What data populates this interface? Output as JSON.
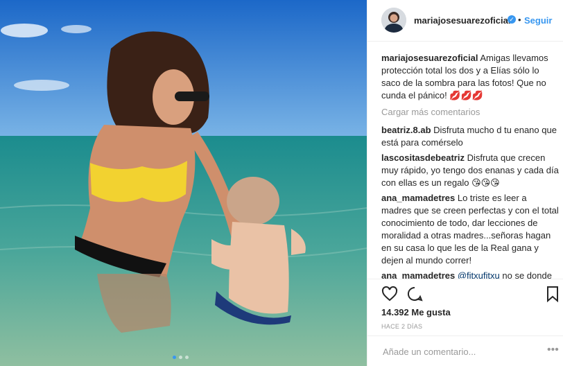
{
  "post": {
    "username": "mariajosesuarezoficial",
    "verified_icon": "verified-badge-icon",
    "separator": "•",
    "follow_label": "Seguir",
    "caption_user": "mariajosesuarezoficial",
    "caption_text": "Amigas llevamos protección total los dos y a Elías sólo lo saco de la sombra para las fotos! Que no cunda el pánico! 💋💋💋",
    "load_more": "Cargar más comentarios",
    "comments": [
      {
        "user": "beatriz.8.ab",
        "text": "Disfruta mucho d tu enano que está para comérselo"
      },
      {
        "user": "lascositasdebeatriz",
        "text": "Disfruta que crecen muy rápido, yo tengo dos enanas y cada día con ellas es un regalo 😘😘😘"
      },
      {
        "user": "ana_mamadetres",
        "text": "Lo triste es leer a madres que se creen perfectas y con el total conocimiento de todo, dar lecciones de moralidad a otras madres...señoras hagan en su casa lo que les de la Real gana y dejen al mundo correr!"
      },
      {
        "user": "ana_mamadetres",
        "mention": "@fitxufitxu",
        "text": "no se donde vives tú, pero aquí se recomienda"
      }
    ],
    "likes": "14.392 Me gusta",
    "time_ago": "HACE 2 DÍAS",
    "add_comment_placeholder": "Añade un comentario...",
    "more_options": "•••"
  },
  "icons": {
    "like": "heart-icon",
    "comment": "comment-icon",
    "save": "bookmark-icon"
  },
  "carousel": {
    "count": 3,
    "active": 0
  },
  "colors": {
    "accent": "#3897f0",
    "border": "#efefef",
    "muted": "#999999"
  }
}
